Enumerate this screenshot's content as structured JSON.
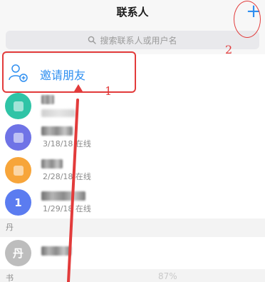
{
  "navbar": {
    "title": "联系人",
    "add_label": "+"
  },
  "search": {
    "placeholder": "搜索联系人或用户名"
  },
  "invite": {
    "label": "邀请朋友"
  },
  "contacts": [
    {
      "status": "",
      "avatar_color": "#2fc4a6"
    },
    {
      "status": "3/18/18 在线",
      "avatar_color": "#6f73e6"
    },
    {
      "status": "2/28/18 在线",
      "avatar_color": "#f7a53a"
    },
    {
      "status": "1/29/18 在线",
      "avatar_color": "#5b7cf0",
      "avatar_text": "1"
    }
  ],
  "sections": [
    {
      "label": "丹",
      "contacts": [
        {
          "avatar_text": "丹",
          "avatar_color": "#bdbdbd"
        }
      ]
    },
    {
      "label": "书"
    }
  ],
  "scroll_indicator": "87%",
  "annotations": {
    "num1": "1",
    "num2": "2"
  }
}
